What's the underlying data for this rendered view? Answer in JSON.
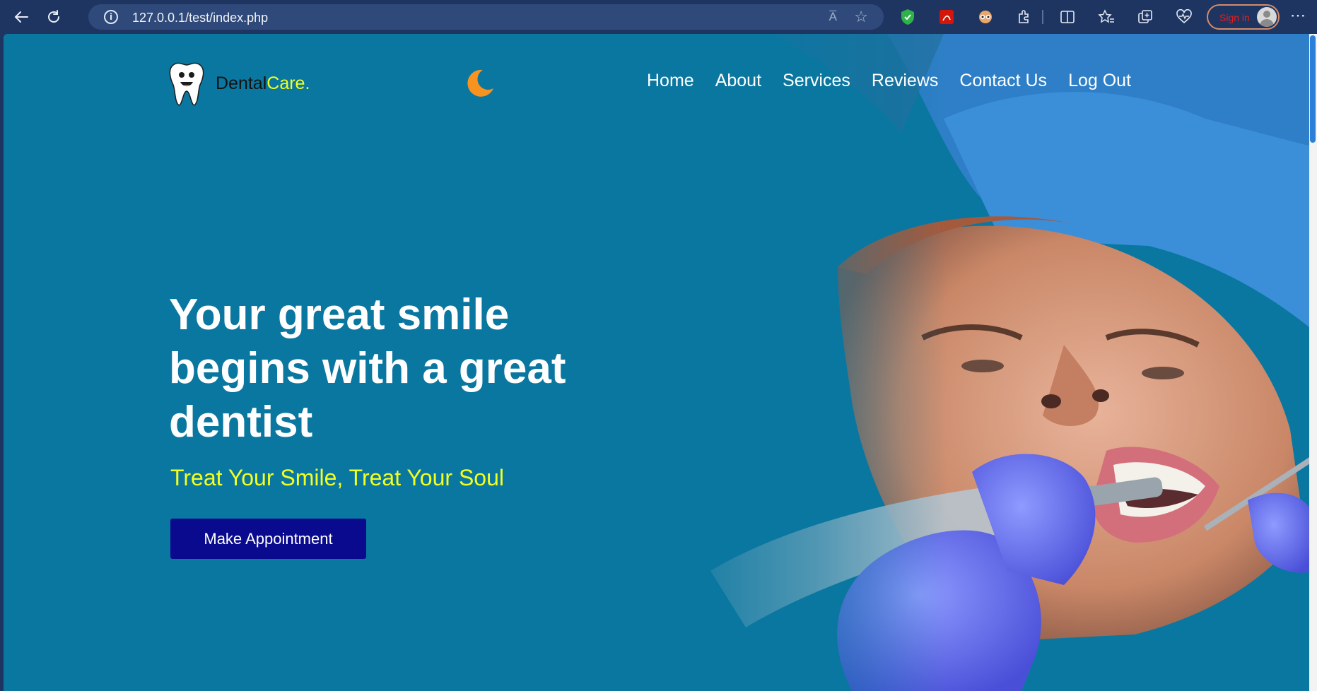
{
  "browser": {
    "url": "127.0.0.1/test/index.php",
    "read_aloud_label": "A̅",
    "signin_label": "Sign in",
    "more_label": "⋯"
  },
  "site": {
    "brand": {
      "part1": "Dental",
      "part2": "Care."
    },
    "nav": [
      "Home",
      "About",
      "Services",
      "Reviews",
      "Contact Us",
      "Log Out"
    ],
    "hero": {
      "title": "Your great smile begins with a great dentist",
      "subtitle": "Treat Your Smile, Treat Your Soul",
      "cta": "Make Appointment"
    }
  },
  "colors": {
    "background": "#0a77a0",
    "accent_yellow": "#f3ff21",
    "button_bg": "#0a0a8e",
    "moon": "#f7931e"
  },
  "icons": {
    "back": "back-arrow-icon",
    "refresh": "refresh-icon",
    "info": "info-icon",
    "favorite": "star-icon",
    "moon": "moon-icon",
    "logo": "tooth-icon"
  }
}
